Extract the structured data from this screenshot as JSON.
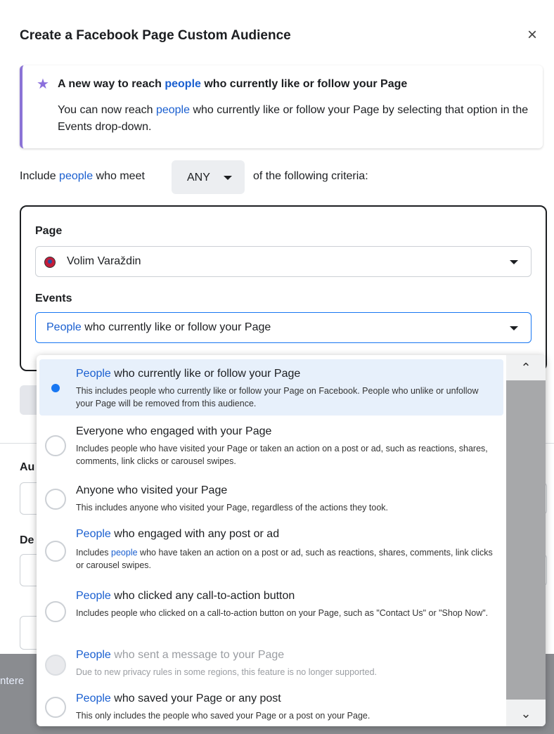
{
  "dialog": {
    "title": "Create a Facebook Page Custom Audience",
    "close_icon": "×"
  },
  "banner": {
    "icon": "star-icon",
    "title_prefix": "A new way to reach ",
    "title_link": "people",
    "title_suffix": " who currently like or follow your Page",
    "body_prefix": "You can now reach ",
    "body_link": "people",
    "body_suffix": " who currently like or follow your Page by selecting that option in the Events drop-down."
  },
  "criteria": {
    "include_prefix": "Include ",
    "include_link": "people",
    "include_suffix": " who meet",
    "match_value": "ANY",
    "after_text": "of the following criteria:"
  },
  "rule": {
    "page_label": "Page",
    "page_value": "Volim Varaždin",
    "events_label": "Events",
    "events_link": "People",
    "events_suffix": " who currently like or follow your Page"
  },
  "background_partial": {
    "audience_label_fragment": "Au",
    "description_label_fragment": "De",
    "left_link_fragment": "ntere"
  },
  "dropdown": {
    "options": [
      {
        "link": "People",
        "title": " who currently like or follow your Page",
        "desc": "This includes people who currently like or follow your Page on Facebook. People who unlike or unfollow your Page will be removed from this audience.",
        "selected": true,
        "disabled": false
      },
      {
        "link": "",
        "title": "Everyone who engaged with your Page",
        "desc": "Includes people who have visited your Page or taken an action on a post or ad, such as reactions, shares, comments, link clicks or carousel swipes.",
        "selected": false,
        "disabled": false
      },
      {
        "link": "",
        "title": "Anyone who visited your Page",
        "desc": "This includes anyone who visited your Page, regardless of the actions they took.",
        "selected": false,
        "disabled": false
      },
      {
        "link": "People",
        "title": " who engaged with any post or ad",
        "desc_prefix": "Includes ",
        "desc_link": "people",
        "desc": " who have taken an action on a post or ad, such as reactions, shares, comments, link clicks or carousel swipes.",
        "selected": false,
        "disabled": false
      },
      {
        "link": "People",
        "title": " who clicked any call-to-action button",
        "desc": "Includes people who clicked on a call-to-action button on your Page, such as \"Contact Us\" or \"Shop Now\".",
        "selected": false,
        "disabled": false
      },
      {
        "link": "People",
        "title": " who sent a message to your Page",
        "desc": "Due to new privacy rules in some regions, this feature is no longer supported.",
        "selected": false,
        "disabled": true
      },
      {
        "link": "People",
        "title": " who saved your Page or any post",
        "desc": "This only includes the people who saved your Page or a post on your Page.",
        "selected": false,
        "disabled": false
      }
    ]
  },
  "colors": {
    "link": "#1a5fd0",
    "accent": "#1877f2",
    "banner_border": "#8b73d6"
  }
}
